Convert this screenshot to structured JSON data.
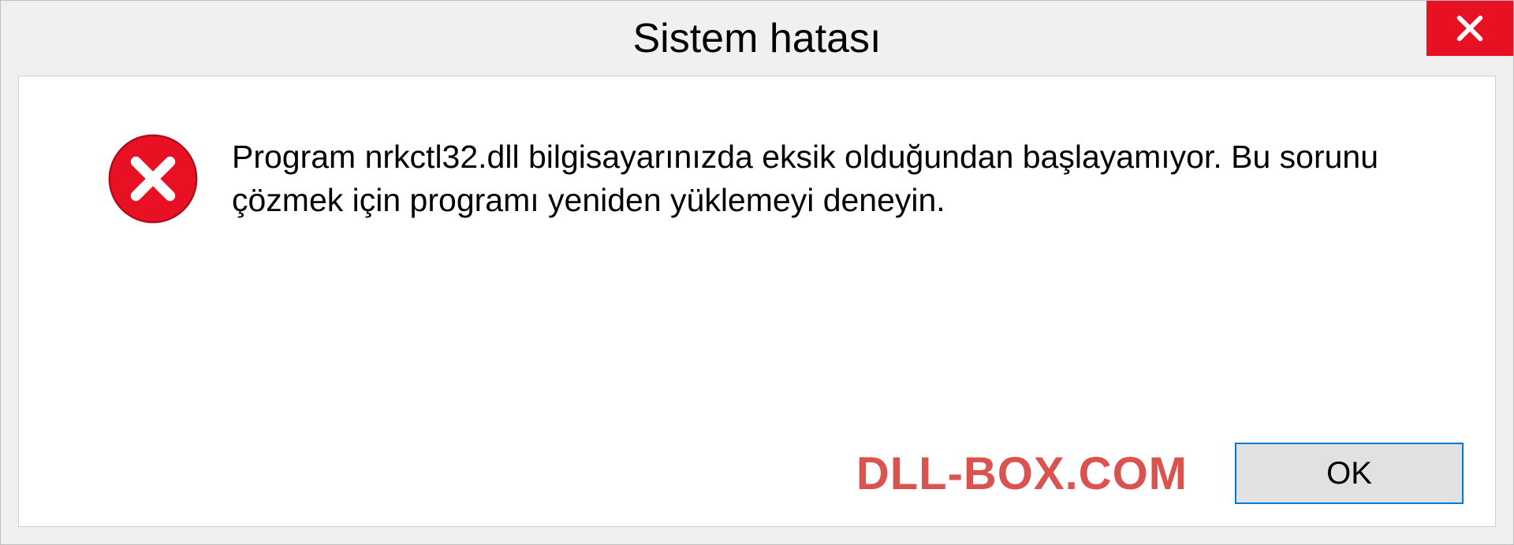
{
  "dialog": {
    "title": "Sistem hatası",
    "message": "Program nrkctl32.dll bilgisayarınızda eksik olduğundan başlayamıyor. Bu sorunu çözmek için programı yeniden yüklemeyi deneyin.",
    "ok_label": "OK"
  },
  "watermark": "DLL-BOX.COM",
  "colors": {
    "close_bg": "#e81123",
    "error_icon": "#e81123",
    "watermark": "#d9534f",
    "ok_border": "#0078d7"
  }
}
